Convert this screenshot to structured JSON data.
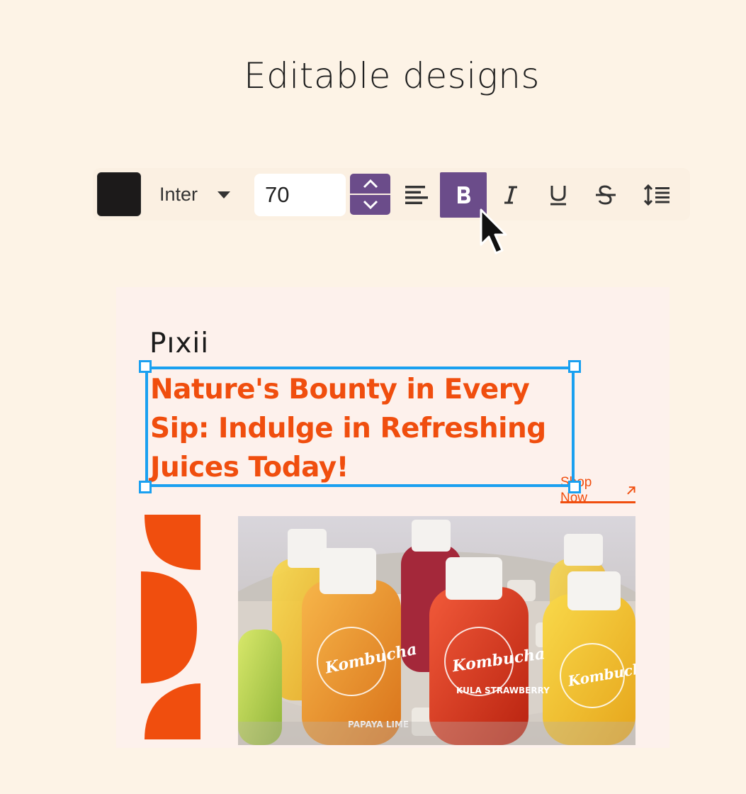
{
  "page": {
    "heading": "Editable designs"
  },
  "colors": {
    "background": "#fdf3e6",
    "accent_purple": "#6b4c8a",
    "brand_orange": "#f04e0e",
    "selection_blue": "#1aa0f0",
    "text_color_swatch": "#1c1a1a"
  },
  "toolbar": {
    "font_family": "Inter",
    "font_size": "70",
    "buttons": {
      "align": "align-left-icon",
      "bold": "B",
      "italic": "I",
      "underline": "U",
      "strikethrough": "S",
      "line_height": "line-height-icon"
    },
    "bold_active": true
  },
  "design": {
    "brand": "Pıxii",
    "headline": "Nature's Bounty in Every Sip: Indulge in Refreshing Juices Today!",
    "cta": "Shop Now",
    "photo_labels": [
      "Kombucha",
      "PAPAYA LIME",
      "KULA STRAWBERRY"
    ]
  }
}
